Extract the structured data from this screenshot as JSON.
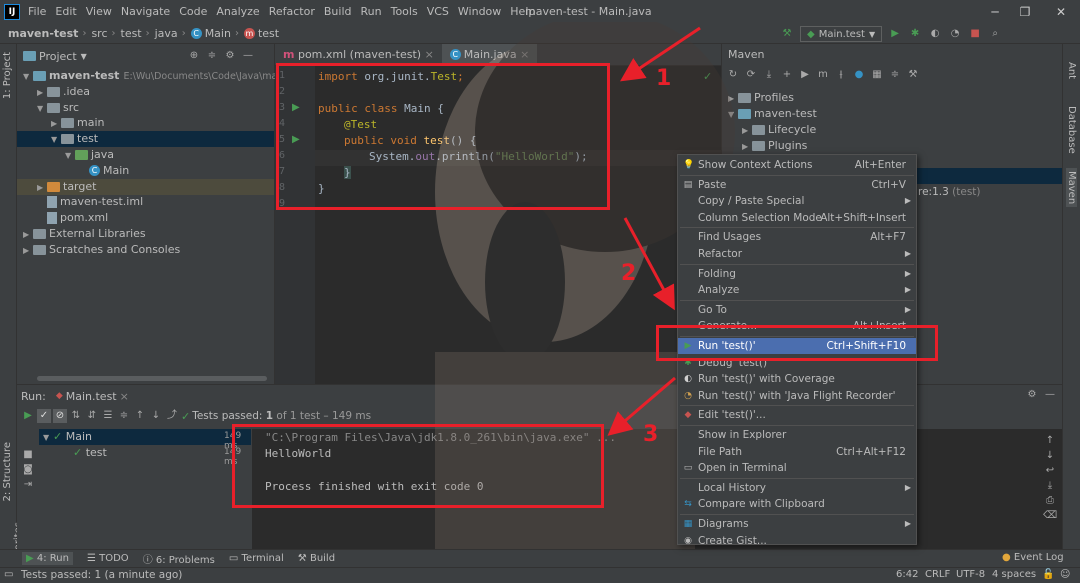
{
  "window": {
    "title": "maven-test - Main.java",
    "menu": [
      "File",
      "Edit",
      "View",
      "Navigate",
      "Code",
      "Analyze",
      "Refactor",
      "Build",
      "Run",
      "Tools",
      "VCS",
      "Window",
      "Help"
    ],
    "controls": [
      "─",
      "❐",
      "✕"
    ]
  },
  "breadcrumb": [
    "maven-test",
    "src",
    "test",
    "java",
    "Main",
    "test"
  ],
  "run_config": "Main.test",
  "left_tabs": [
    "1: Project",
    "2: Structure",
    "2: Favorites"
  ],
  "right_tabs": [
    "Ant",
    "Database",
    "Maven"
  ],
  "project": {
    "title": "Project",
    "tree": [
      {
        "label": "maven-test",
        "extra": "E:\\Wu\\Documents\\Code\\Java\\mave",
        "kind": "folder-blue",
        "depth": 0,
        "arrow": "▼",
        "bold": true
      },
      {
        "label": ".idea",
        "kind": "folder",
        "depth": 1,
        "arrow": "▶"
      },
      {
        "label": "src",
        "kind": "folder",
        "depth": 1,
        "arrow": "▼"
      },
      {
        "label": "main",
        "kind": "folder",
        "depth": 2,
        "arrow": "▶"
      },
      {
        "label": "test",
        "kind": "folder",
        "depth": 2,
        "arrow": "▼",
        "selected": true
      },
      {
        "label": "java",
        "kind": "folder-green",
        "depth": 3,
        "arrow": "▼"
      },
      {
        "label": "Main",
        "kind": "class",
        "depth": 4,
        "arrow": ""
      },
      {
        "label": "target",
        "kind": "folder-orange",
        "depth": 1,
        "arrow": "▶",
        "highlight": true
      },
      {
        "label": "maven-test.iml",
        "kind": "file",
        "depth": 1,
        "arrow": ""
      },
      {
        "label": "pom.xml",
        "kind": "file",
        "depth": 1,
        "arrow": ""
      },
      {
        "label": "External Libraries",
        "kind": "folder",
        "depth": 0,
        "arrow": "▶"
      },
      {
        "label": "Scratches and Consoles",
        "kind": "folder",
        "depth": 0,
        "arrow": "▶"
      }
    ]
  },
  "editor": {
    "tabs": [
      {
        "label": "pom.xml (maven-test)",
        "active": false
      },
      {
        "label": "Main.java",
        "active": true
      }
    ],
    "lines": [
      "1",
      "2",
      "3",
      "4",
      "5",
      "6",
      "7",
      "8",
      "9"
    ],
    "code": {
      "l1_kw": "import ",
      "l1_rest": "org.junit.",
      "l1_cls": "Test",
      "l3_kw": "public class ",
      "l3_rest": "Main {",
      "l4": "@Test",
      "l5_kw": "public void ",
      "l5_fn": "test",
      "l5_rest": "() {",
      "l6_a": "System.",
      "l6_fld": "out",
      "l6_b": ".println(",
      "l6_str": "\"HelloWorld\"",
      "l6_c": ");",
      "l7": "}",
      "l8": "}"
    }
  },
  "maven": {
    "title": "Maven",
    "tree": [
      {
        "label": "Profiles",
        "depth": 0
      },
      {
        "label": "maven-test",
        "depth": 0
      },
      {
        "label": "Lifecycle",
        "depth": 1
      },
      {
        "label": "Plugins",
        "depth": 1
      }
    ],
    "dep_suffix": "re:1.3",
    "dep_scope": "(test)"
  },
  "context_menu": {
    "items": [
      {
        "label": "Show Context Actions",
        "shortcut": "Alt+Enter",
        "icon": "bulb-icon"
      },
      {
        "sep": true
      },
      {
        "label": "Paste",
        "shortcut": "Ctrl+V",
        "icon": "clipboard-icon"
      },
      {
        "label": "Copy / Paste Special",
        "submenu": true
      },
      {
        "label": "Column Selection Mode",
        "shortcut": "Alt+Shift+Insert"
      },
      {
        "sep": true
      },
      {
        "label": "Find Usages",
        "shortcut": "Alt+F7"
      },
      {
        "label": "Refactor",
        "submenu": true
      },
      {
        "sep": true
      },
      {
        "label": "Folding",
        "submenu": true
      },
      {
        "label": "Analyze",
        "submenu": true
      },
      {
        "sep": true
      },
      {
        "label": "Go To",
        "submenu": true
      },
      {
        "label": "Generate...",
        "shortcut": "Alt+Insert"
      },
      {
        "sep": true
      },
      {
        "label": "Run 'test()'",
        "shortcut": "Ctrl+Shift+F10",
        "icon": "run-icon",
        "selected": true
      },
      {
        "label": "Debug 'test()'",
        "icon": "debug-icon"
      },
      {
        "label": "Run 'test()' with Coverage",
        "icon": "coverage-icon"
      },
      {
        "label": "Run 'test()' with 'Java Flight Recorder'",
        "icon": "flight-recorder-icon"
      },
      {
        "sep": true
      },
      {
        "label": "Edit 'test()'...",
        "icon": "edit-config-icon"
      },
      {
        "sep": true
      },
      {
        "label": "Show in Explorer"
      },
      {
        "label": "File Path",
        "shortcut": "Ctrl+Alt+F12"
      },
      {
        "label": "Open in Terminal",
        "icon": "terminal-icon"
      },
      {
        "sep": true
      },
      {
        "label": "Local History",
        "submenu": true
      },
      {
        "label": "Compare with Clipboard",
        "icon": "compare-icon"
      },
      {
        "sep": true
      },
      {
        "label": "Diagrams",
        "submenu": true,
        "icon": "diagram-icon"
      },
      {
        "label": "Create Gist...",
        "icon": "github-icon"
      }
    ]
  },
  "run_panel": {
    "title": "Run:",
    "config": "Main.test",
    "tests_passed": "Tests passed:",
    "tests_count": "1",
    "tests_of": "of 1 test – 149 ms",
    "tree": [
      {
        "label": "Main",
        "time": "149 ms"
      },
      {
        "label": "test",
        "time": "149 ms"
      }
    ],
    "console": [
      "\"C:\\Program Files\\Java\\jdk1.8.0_261\\bin\\java.exe\" ...",
      "HelloWorld",
      "",
      "Process finished with exit code 0"
    ]
  },
  "bottom_tabs": [
    "4: Run",
    "TODO",
    "6: Problems",
    "Terminal",
    "Build"
  ],
  "event_log": "Event Log",
  "status": {
    "message": "Tests passed: 1 (a minute ago)",
    "position": "6:42",
    "line_sep": "CRLF",
    "encoding": "UTF-8",
    "indent": "4 spaces"
  },
  "annotations": [
    "1",
    "2",
    "3"
  ],
  "colors": {
    "accent": "#4b6eaf",
    "annotation": "#e8202a",
    "run_green": "#499c54"
  }
}
